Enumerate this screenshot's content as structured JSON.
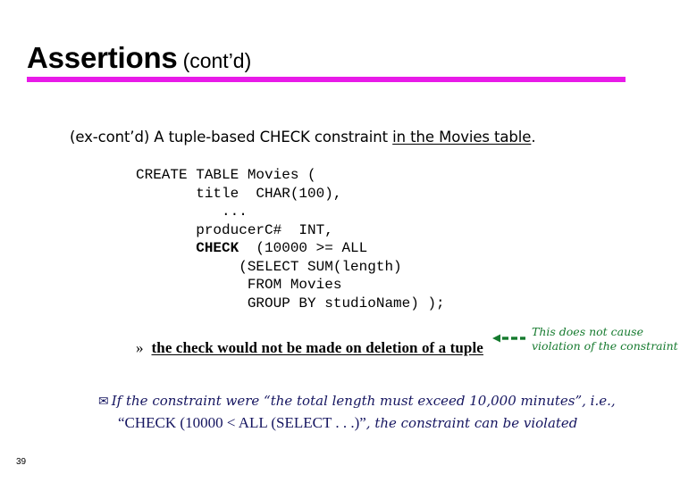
{
  "slide": {
    "title_main": "Assertions",
    "title_sub": "(cont’d)",
    "rule_color": "#E81AE8",
    "page_number": "39"
  },
  "caption": {
    "plain": "(ex-cont’d) A tuple-based CHECK constraint ",
    "underlined": "in the Movies table",
    "tail": "."
  },
  "code": {
    "line1": "CREATE TABLE Movies (",
    "line2": "       title  CHAR(100),",
    "line3": "          ...",
    "line4": "       producerC#  INT,",
    "line5_keyword": "       CHECK",
    "line5_rest": "  (10000 >= ALL",
    "line6": "            (SELECT SUM(length)",
    "line7": "             FROM Movies",
    "line8": "             GROUP BY studioName) );"
  },
  "bullet": {
    "marker": "»",
    "text": "the check would not be made on deletion of a tuple"
  },
  "annotation": {
    "arrow_color": "#157A2E",
    "line1": "This does not cause",
    "line2": "violation of the constraint"
  },
  "note": {
    "bullet_glyph": "✉",
    "line1_a": "If the constraint were ",
    "line1_quote": "“the total length must exceed 10,000 minutes”",
    "line1_b": ", i.e.,",
    "line2_quote_open": "“",
    "line2_code": "CHECK (10000 < ALL (SELECT . . .)",
    "line2_quote_close": "”",
    "line2_tail": ", the constraint can be violated",
    "color": "#151560"
  }
}
